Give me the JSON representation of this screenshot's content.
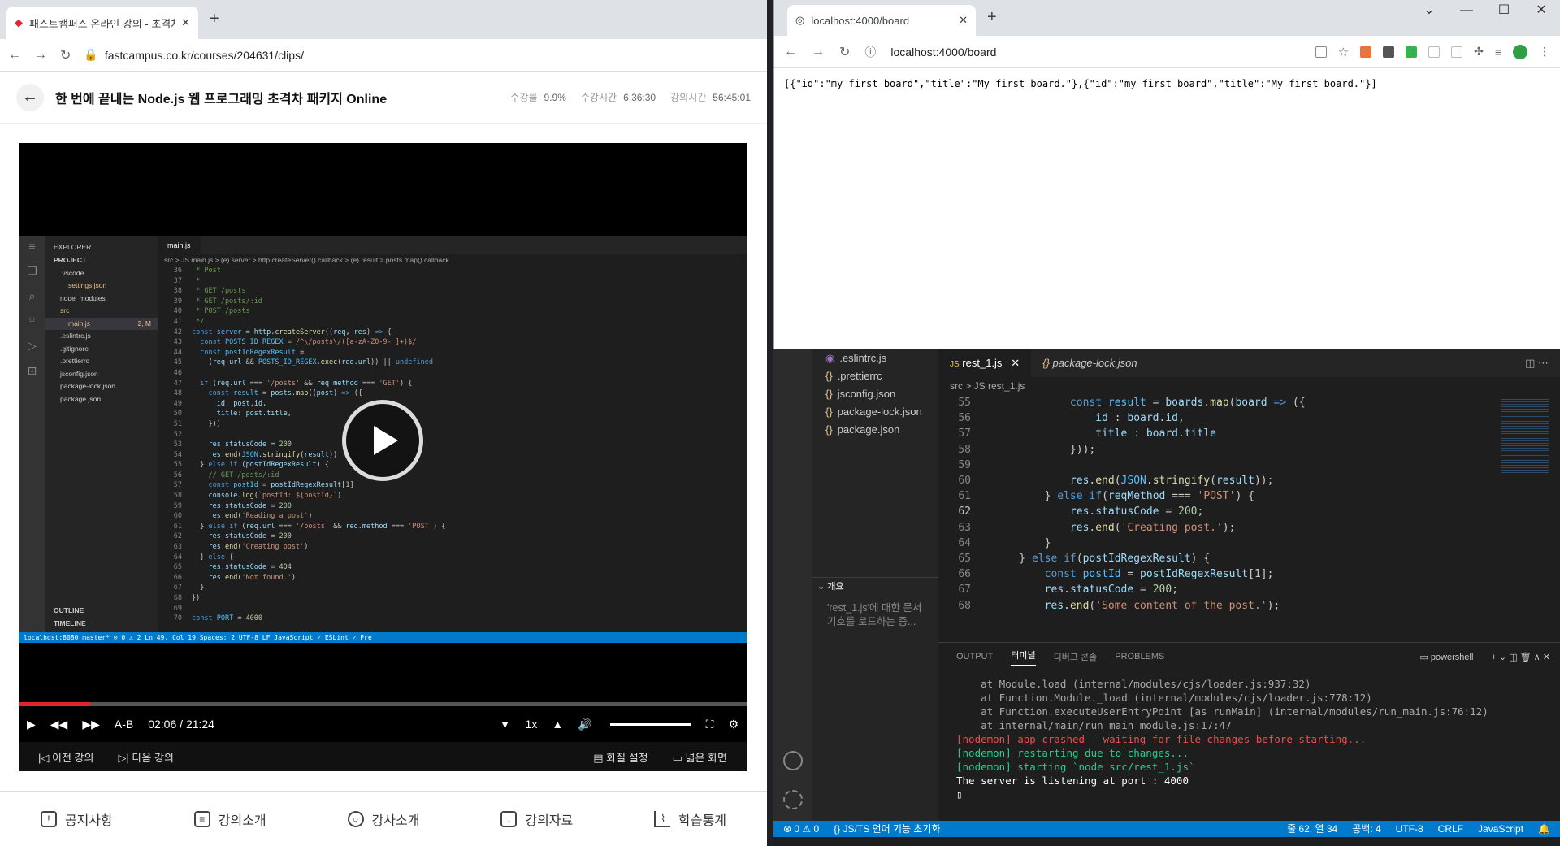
{
  "left_browser": {
    "tab_title": "패스트캠퍼스 온라인 강의 - 초격차",
    "url": "fastcampus.co.kr/courses/204631/clips/"
  },
  "course": {
    "title": "한 번에 끝내는 Node.js 웹 프로그래밍 초격차 패키지 Online",
    "stats": [
      {
        "label": "수강률",
        "value": "9.9%"
      },
      {
        "label": "수강시간",
        "value": "6:36:30"
      },
      {
        "label": "강의시간",
        "value": "56:45:01"
      }
    ]
  },
  "video_vscode": {
    "explorer_title": "EXPLORER",
    "project": "PROJECT",
    "files": [
      ".vscode",
      "settings.json",
      "node_modules",
      "src",
      "main.js",
      ".eslintrc.js",
      ".gitignore",
      ".prettierrc",
      "jsconfig.json",
      "package-lock.json",
      "package.json"
    ],
    "main_badge": "2, M",
    "tab": "main.js",
    "breadcrumb": "src > JS main.js > (e) server > http.createServer() callback > (e) result > posts.map() callback",
    "outline": "OUTLINE",
    "timeline": "TIMELINE",
    "status": "localhost:8080   master*   ⊘ 0 ⚠ 2                                                                                    Ln 49, Col 19   Spaces: 2   UTF-8   LF   JavaScript   ✓ ESLint   ✓ Pre"
  },
  "player": {
    "time_current": "02:06",
    "time_total": "21:24",
    "ab": "A-B",
    "speed": "1x",
    "progress": 0.098,
    "prev": "이전 강의",
    "next": "다음 강의",
    "quality": "화질 설정",
    "wide": "넓은 화면"
  },
  "bottom_nav": [
    "공지사항",
    "강의소개",
    "강사소개",
    "강의자료",
    "학습통계"
  ],
  "right_browser": {
    "tab_title": "localhost:4000/board",
    "url": "localhost:4000/board",
    "body": "[{\"id\":\"my_first_board\",\"title\":\"My first board.\"},{\"id\":\"my_first_board\",\"title\":\"My first board.\"}]"
  },
  "right_vscode": {
    "files": [
      ".eslintrc.js",
      ".prettierrc",
      "jsconfig.json",
      "package-lock.json",
      "package.json"
    ],
    "outline_title": "개요",
    "outline_msg": "'rest_1.js'에 대한 문서 기호를 로드하는 중...",
    "tabs": [
      "rest_1.js",
      "package-lock.json"
    ],
    "breadcrumb": "src > JS rest_1.js",
    "panel_tabs": [
      "OUTPUT",
      "터미널",
      "디버그 콘솔",
      "PROBLEMS"
    ],
    "shell": "powershell",
    "terminal": [
      "    at Module.load (internal/modules/cjs/loader.js:937:32)",
      "    at Function.Module._load (internal/modules/cjs/loader.js:778:12)",
      "    at Function.executeUserEntryPoint [as runMain] (internal/modules/run_main.js:76:12)",
      "    at internal/main/run_main_module.js:17:47",
      "[nodemon] app crashed - waiting for file changes before starting...",
      "[nodemon] restarting due to changes...",
      "[nodemon] starting `node src/rest_1.js`",
      "The server is listening at port : 4000"
    ],
    "status": {
      "errors": "⊗ 0 ⚠ 0",
      "lang_init": "JS/TS 언어 기능 초기화",
      "pos": "줄 62, 열 34",
      "spaces": "공백: 4",
      "enc": "UTF-8",
      "eol": "CRLF",
      "lang": "JavaScript"
    }
  }
}
